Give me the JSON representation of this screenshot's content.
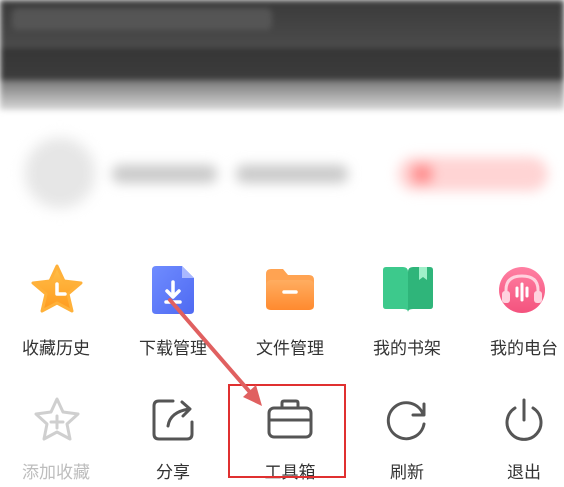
{
  "menu": {
    "row1": [
      {
        "label": "收藏历史",
        "icon": "star-clock-icon"
      },
      {
        "label": "下载管理",
        "icon": "download-doc-icon"
      },
      {
        "label": "文件管理",
        "icon": "folder-icon"
      },
      {
        "label": "我的书架",
        "icon": "book-icon"
      },
      {
        "label": "我的电台",
        "icon": "radio-headphones-icon"
      }
    ],
    "row2": [
      {
        "label": "添加收藏",
        "icon": "star-plus-icon",
        "disabled": true
      },
      {
        "label": "分享",
        "icon": "share-icon"
      },
      {
        "label": "工具箱",
        "icon": "toolbox-icon"
      },
      {
        "label": "刷新",
        "icon": "refresh-icon"
      },
      {
        "label": "退出",
        "icon": "power-icon"
      }
    ]
  },
  "annotation": {
    "highlight_color": "#e03030",
    "arrow_color": "#e06060"
  }
}
